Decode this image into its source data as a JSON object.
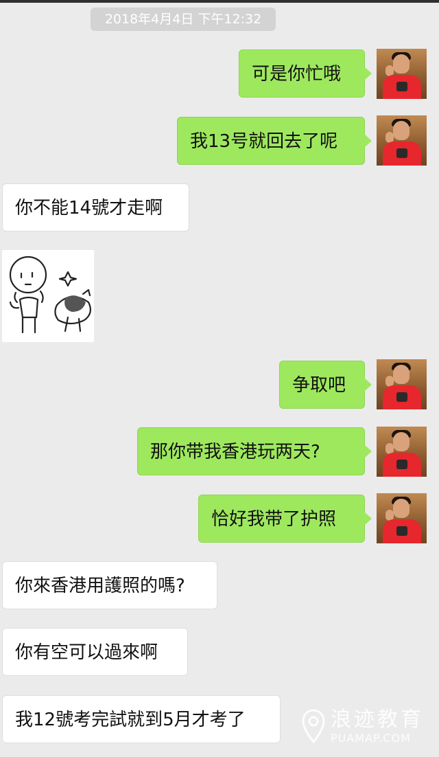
{
  "chat": {
    "timestamp": "2018年4月4日 下午12:32",
    "messages": [
      {
        "side": "me",
        "text": "可是你忙哦"
      },
      {
        "side": "me",
        "text": "我13号就回去了呢"
      },
      {
        "side": "them",
        "text": "你不能14號才走啊"
      },
      {
        "side": "them",
        "type": "sticker"
      },
      {
        "side": "me",
        "text": "争取吧"
      },
      {
        "side": "me",
        "text": "那你带我香港玩两天?"
      },
      {
        "side": "me",
        "text": "恰好我带了护照"
      },
      {
        "side": "them",
        "text": "你來香港用護照的嗎?"
      },
      {
        "side": "them",
        "text": "你有空可以過來啊"
      },
      {
        "side": "them",
        "text": "我12號考完試就到5月才考了"
      }
    ]
  },
  "watermark": {
    "name": "浪迹教育",
    "site": "PUAMAP.COM"
  },
  "colors": {
    "background": "#ebebeb",
    "my_bubble": "#9ee85e",
    "their_bubble": "#ffffff",
    "timestamp_bg": "#d3d3d3"
  }
}
